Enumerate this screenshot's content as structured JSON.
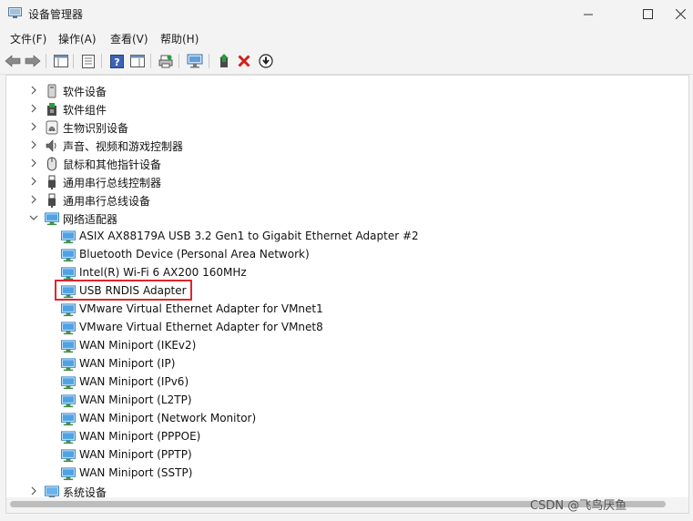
{
  "window": {
    "title": "设备管理器"
  },
  "menubar": [
    "文件(F)",
    "操作(A)",
    "查看(V)",
    "帮助(H)"
  ],
  "tree": {
    "rows": [
      {
        "label": "软件设备",
        "icon": "software-device-icon",
        "expand": "collapsed"
      },
      {
        "label": "软件组件",
        "icon": "software-component-icon",
        "expand": "collapsed"
      },
      {
        "label": "生物识别设备",
        "icon": "fingerprint-icon",
        "expand": "collapsed"
      },
      {
        "label": "声音、视频和游戏控制器",
        "icon": "speaker-icon",
        "expand": "collapsed"
      },
      {
        "label": "鼠标和其他指针设备",
        "icon": "mouse-icon",
        "expand": "collapsed"
      },
      {
        "label": "通用串行总线控制器",
        "icon": "usb-icon",
        "expand": "collapsed"
      },
      {
        "label": "通用串行总线设备",
        "icon": "usb-icon",
        "expand": "collapsed"
      },
      {
        "label": "网络适配器",
        "icon": "network-adapter-icon",
        "expand": "expanded"
      },
      {
        "label": "ASIX AX88179A USB 3.2 Gen1 to Gigabit Ethernet Adapter #2",
        "icon": "network-adapter-icon",
        "child": true
      },
      {
        "label": "Bluetooth Device (Personal Area Network)",
        "icon": "network-adapter-icon",
        "child": true
      },
      {
        "label": "Intel(R) Wi-Fi 6 AX200 160MHz",
        "icon": "network-adapter-icon",
        "child": true
      },
      {
        "label": "USB RNDIS Adapter",
        "icon": "network-adapter-icon",
        "child": true,
        "highlighted": true
      },
      {
        "label": "VMware Virtual Ethernet Adapter for VMnet1",
        "icon": "network-adapter-icon",
        "child": true
      },
      {
        "label": "VMware Virtual Ethernet Adapter for VMnet8",
        "icon": "network-adapter-icon",
        "child": true
      },
      {
        "label": "WAN Miniport (IKEv2)",
        "icon": "network-adapter-icon",
        "child": true
      },
      {
        "label": "WAN Miniport (IP)",
        "icon": "network-adapter-icon",
        "child": true
      },
      {
        "label": "WAN Miniport (IPv6)",
        "icon": "network-adapter-icon",
        "child": true
      },
      {
        "label": "WAN Miniport (L2TP)",
        "icon": "network-adapter-icon",
        "child": true
      },
      {
        "label": "WAN Miniport (Network Monitor)",
        "icon": "network-adapter-icon",
        "child": true
      },
      {
        "label": "WAN Miniport (PPPOE)",
        "icon": "network-adapter-icon",
        "child": true
      },
      {
        "label": "WAN Miniport (PPTP)",
        "icon": "network-adapter-icon",
        "child": true
      },
      {
        "label": "WAN Miniport (SSTP)",
        "icon": "network-adapter-icon",
        "child": true
      },
      {
        "label": "系统设备",
        "icon": "system-device-icon",
        "expand": "collapsed"
      }
    ]
  },
  "watermark": "CSDN @飞鸟厌鱼",
  "colors": {
    "highlight_border": "#e0252b",
    "network_icon": "#2f7fc8",
    "delete_icon": "#d11f1f",
    "update_icon": "#2e9a3e"
  }
}
